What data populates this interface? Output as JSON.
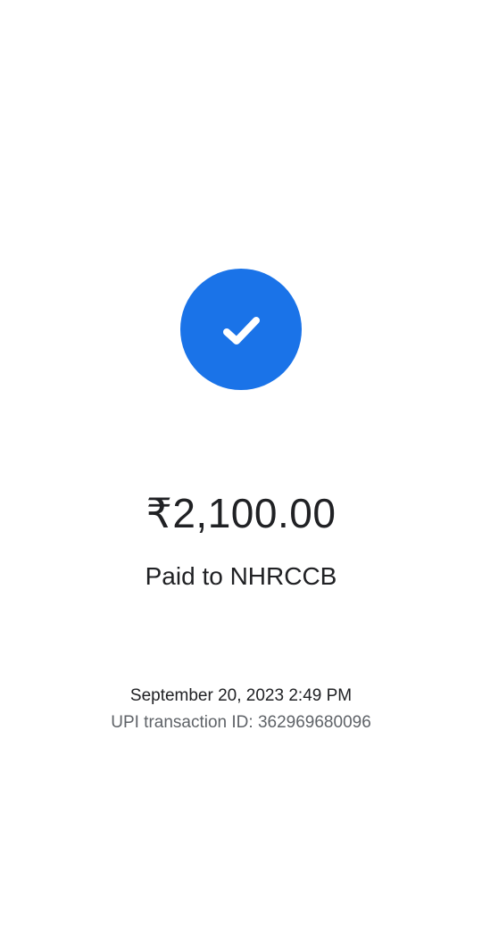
{
  "status": {
    "icon": "check-circle-icon",
    "accent_color": "#1a73e8"
  },
  "payment": {
    "amount": "₹2,100.00",
    "paid_to": "Paid to NHRCCB"
  },
  "details": {
    "datetime": "September 20, 2023 2:49 PM",
    "transaction_id": "UPI transaction ID: 362969680096"
  }
}
